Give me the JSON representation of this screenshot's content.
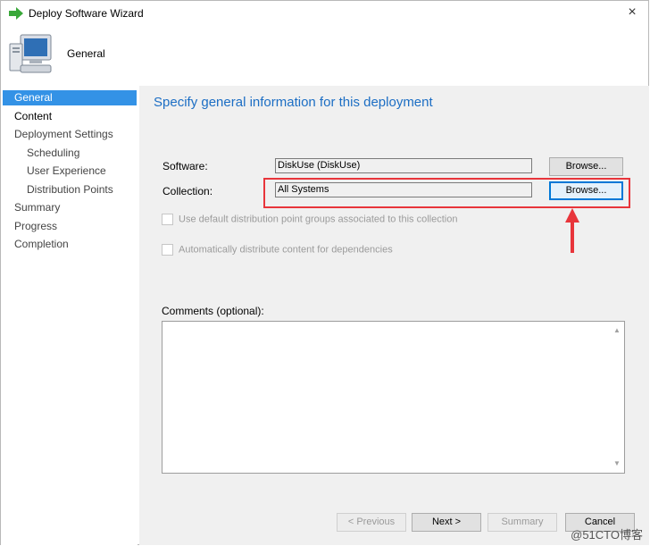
{
  "window": {
    "title": "Deploy Software Wizard",
    "close_glyph": "×"
  },
  "header": {
    "page_name": "General"
  },
  "sidebar": {
    "items": [
      {
        "label": "General"
      },
      {
        "label": "Content"
      },
      {
        "label": "Deployment Settings"
      },
      {
        "label": "Scheduling"
      },
      {
        "label": "User Experience"
      },
      {
        "label": "Distribution Points"
      },
      {
        "label": "Summary"
      },
      {
        "label": "Progress"
      },
      {
        "label": "Completion"
      }
    ]
  },
  "main": {
    "title": "Specify general information for this deployment",
    "software": {
      "label": "Software:",
      "value": "DiskUse (DiskUse)",
      "browse_label": "Browse..."
    },
    "collection": {
      "label": "Collection:",
      "value": "All Systems",
      "browse_label": "Browse..."
    },
    "options": {
      "use_default_dp_label": "Use default distribution point groups associated to this collection",
      "auto_distribute_label": "Automatically distribute content for dependencies"
    },
    "comments": {
      "label": "Comments (optional):",
      "value": ""
    }
  },
  "footer": {
    "previous_label": "< Previous",
    "next_label": "Next >",
    "summary_label": "Summary",
    "cancel_label": "Cancel"
  },
  "watermark": {
    "text": "@51CTO博客"
  },
  "colors": {
    "accent": "#3392e6",
    "title_blue": "#1c6ec4",
    "annotation_red": "#e8353b"
  }
}
